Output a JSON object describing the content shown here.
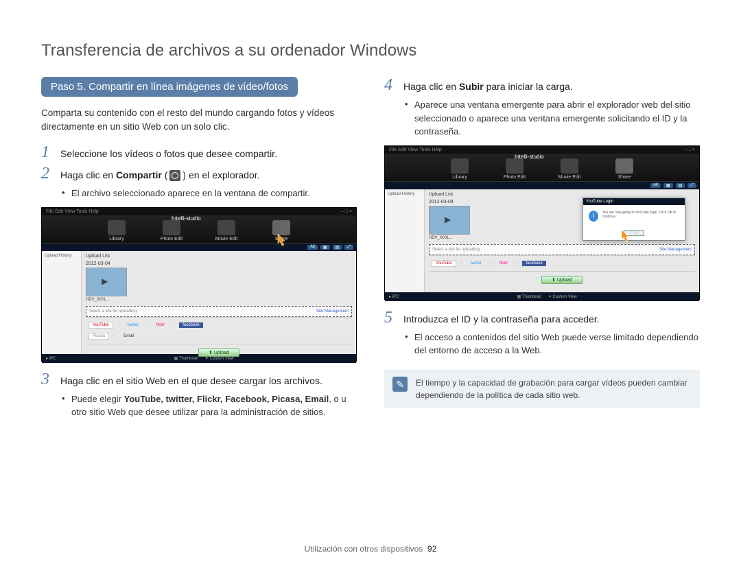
{
  "page": {
    "title": "Transferencia de archivos a su ordenador Windows",
    "footer_section": "Utilización con otros dispositivos",
    "page_number": "92"
  },
  "left": {
    "step_heading": "Paso 5. Compartir en línea imágenes de vídeo/fotos",
    "intro": "Comparta su contenido con el resto del mundo cargando fotos y vídeos directamente en un sitio Web con un solo clic.",
    "step1_num": "1",
    "step1_text": "Seleccione los vídeos o fotos que desee compartir.",
    "step2_num": "2",
    "step2_pre": "Haga clic en ",
    "step2_bold": "Compartir",
    "step2_post": " en el explorador.",
    "step2_bullet": "El archivo seleccionado aparece en la ventana de compartir.",
    "step3_num": "3",
    "step3_text": "Haga clic en el sitio Web en el que desee cargar los archivos.",
    "step3_bullet_pre": "Puede elegir ",
    "step3_bullet_bold": "YouTube, twitter, Flickr, Facebook, Picasa, Email",
    "step3_bullet_post": ", o u otro sitio Web que desee utilizar para la administración de sitios."
  },
  "right": {
    "step4_num": "4",
    "step4_pre": "Haga clic en ",
    "step4_bold": "Subir",
    "step4_post": " para iniciar la carga.",
    "step4_bullet": "Aparece una ventana emergente para abrir el explorador web del sitio seleccionado o aparece una ventana emergente solicitando el ID y la contraseña.",
    "step5_num": "5",
    "step5_text": "Introduzca el ID y la contraseña para acceder.",
    "step5_bullet": "El acceso a contenidos del sitio Web puede verse limitado dependiendo del entorno de acceso a la Web.",
    "note": "El tiempo y la capacidad de grabación para cargar vídeos pueden cambiar dependiendo de la política de cada sitio web."
  },
  "mock": {
    "menu": "File  Edit  View  Tools  Help",
    "app_title": "Intelli-studio",
    "tabs": {
      "library": "Library",
      "photo": "Photo Edit",
      "movie": "Movie Edit",
      "share": "Share"
    },
    "sidebar_title": "Upload History",
    "upload_list": "Upload List",
    "date": "2012-03-04",
    "clip_name": "HDV_0001...",
    "select_hint": "Select a site for uploading.",
    "sites": {
      "youtube": "YouTube",
      "twitter": "twitter",
      "flickr": "flickr",
      "facebook": "facebook",
      "picasa": "Picasa",
      "email": "Email"
    },
    "upload_btn": "Upload",
    "footer_left": "iPC",
    "footer_mid1": "Thumbnail",
    "footer_mid2": "Custom View",
    "toolbar_all": "All",
    "right_link": "Site Management",
    "login": {
      "title": "YouTube Login",
      "msg": "You are now going to YouTube login. Click OK to continue.",
      "ok": "OK"
    }
  }
}
